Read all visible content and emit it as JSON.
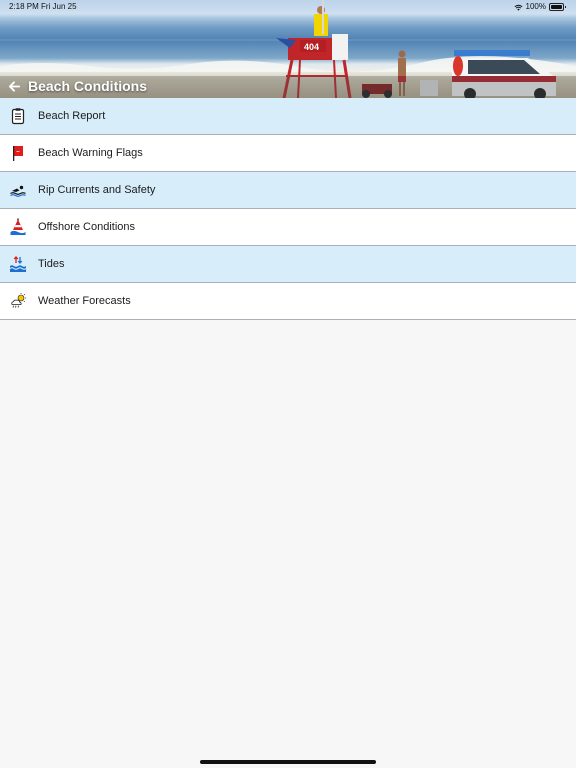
{
  "status": {
    "time": "2:18 PM",
    "date": "Fri Jun 25",
    "battery": "100%"
  },
  "header": {
    "title": "Beach Conditions",
    "back_icon": "back-arrow-icon"
  },
  "menu": {
    "items": [
      {
        "label": "Beach Report",
        "icon": "clipboard-icon"
      },
      {
        "label": "Beach Warning Flags",
        "icon": "red-flag-icon"
      },
      {
        "label": "Rip Currents and Safety",
        "icon": "swimmer-icon"
      },
      {
        "label": "Offshore Conditions",
        "icon": "buoy-icon"
      },
      {
        "label": "Tides",
        "icon": "tide-icon"
      },
      {
        "label": "Weather Forecasts",
        "icon": "weather-icon"
      }
    ]
  },
  "colors": {
    "row_alt": "#d7edfa",
    "row_plain": "#ffffff",
    "divider": "#a9b0b7",
    "background": "#f7f7f7"
  }
}
